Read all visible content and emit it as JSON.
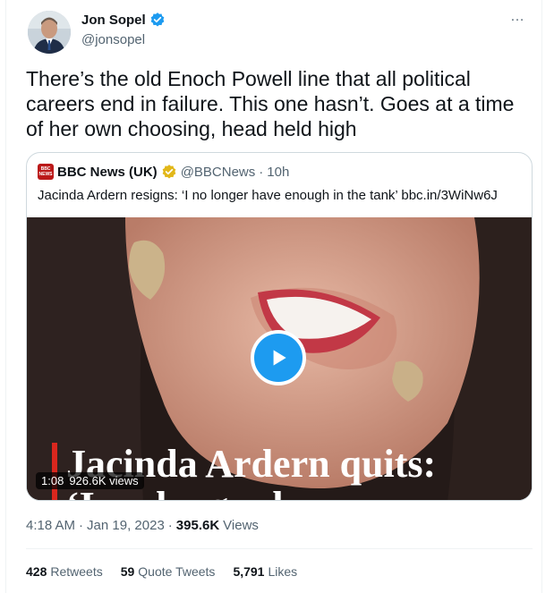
{
  "tweet": {
    "author_name": "Jon Sopel",
    "author_handle": "@jonsopel",
    "more_icon": "…",
    "text": "There’s the old Enoch Powell line that all political careers end in failure. This one hasn’t. Goes at a time of her own choosing, head held high",
    "time": "4:18 AM",
    "date": "Jan 19, 2023",
    "views_count": "395.6K",
    "views_label": "Views"
  },
  "quote": {
    "author_name": "BBC News (UK)",
    "author_handle": "@BBCNews",
    "time": "10h",
    "text": "Jacinda Ardern resigns: ‘I no longer have enough in the tank’ bbc.in/3WiNw6J",
    "logo_text_1": "BBC",
    "logo_text_2": "NEWS",
    "video": {
      "duration": "1:08",
      "views": "926.6K views",
      "overlay_line1": "Jacinda Ardern quits:",
      "overlay_line2": "‘I no longer have"
    }
  },
  "stats": {
    "retweets_count": "428",
    "retweets_label": "Retweets",
    "quotes_count": "59",
    "quotes_label": "Quote Tweets",
    "likes_count": "5,791",
    "likes_label": "Likes"
  },
  "colors": {
    "accent": "#1d9bf0",
    "gold_verified": "#e2b719",
    "bbc_red": "#bb1919"
  }
}
